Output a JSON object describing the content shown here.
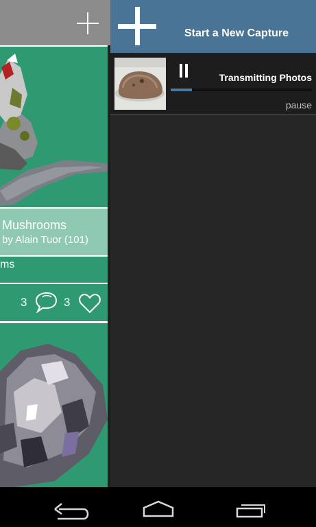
{
  "left_panel": {
    "card": {
      "title": "Mushrooms",
      "author": "by Alain Tuor (101)",
      "tags": "ms",
      "views": "3",
      "comments": "3"
    }
  },
  "right_panel": {
    "header": {
      "new_capture_label": "Start a New Capture"
    },
    "upload": {
      "status": "Transmitting Photos",
      "progress_percent": 15,
      "pause_label": "pause"
    }
  },
  "colors": {
    "card_green": "#2f9a72",
    "card_title_bg": "#8fc9b2",
    "header_blue": "#4a7495",
    "panel_dark": "#262626"
  },
  "icons": {
    "left_add": "plus-icon",
    "new_capture": "plus-icon",
    "pause": "pause-icon",
    "comment": "speech-bubble-icon",
    "like": "heart-icon",
    "nav_back": "back-arrow-icon",
    "nav_home": "home-icon",
    "nav_recents": "recent-apps-icon"
  }
}
